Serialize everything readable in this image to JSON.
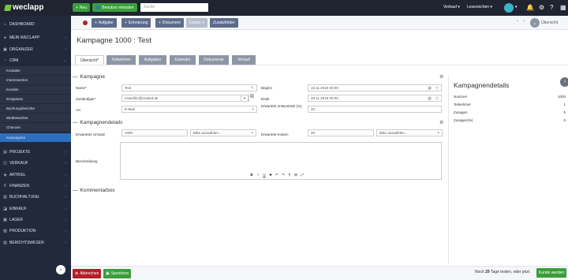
{
  "topbar": {
    "brand": "weclapp",
    "new_label": "Neu",
    "invite_label": "Benutzer einladen",
    "search_placeholder": "Suche",
    "sales_label": "Verkauf",
    "bookmarks_label": "Lesezeichen"
  },
  "sidebar": {
    "items": [
      {
        "label": "DASHBOARD",
        "icon": "dashboard-icon"
      },
      {
        "label": "MEIN WECLAPP",
        "icon": "user-icon"
      },
      {
        "label": "ORGANIZER",
        "icon": "calendar-icon"
      },
      {
        "label": "CRM",
        "icon": "crm-icon"
      }
    ],
    "crm_sub": [
      "Kontakte",
      "Interessenten",
      "Kunden",
      "Ereignisse",
      "Buchungsberichte",
      "Wettbewerber",
      "Chancen",
      "Kampagnen"
    ],
    "modules": [
      {
        "label": "PROJEKTE",
        "icon": "folder-icon"
      },
      {
        "label": "VERKAUF",
        "icon": "cart-icon"
      },
      {
        "label": "ARTIKEL",
        "icon": "tag-icon"
      },
      {
        "label": "FINANZEN",
        "icon": "money-icon"
      },
      {
        "label": "BUCHHALTUNG",
        "icon": "book-icon"
      },
      {
        "label": "EINKAUF",
        "icon": "basket-icon"
      },
      {
        "label": "LAGER",
        "icon": "warehouse-icon"
      },
      {
        "label": "PRODUKTION",
        "icon": "factory-icon"
      },
      {
        "label": "BERICHTSWESEN",
        "icon": "report-icon"
      }
    ]
  },
  "toolbar": {
    "task_label": "Aufgabe",
    "reminder_label": "Erinnerung",
    "document_label": "Dokument",
    "export_label": "Export",
    "extra_fields_label": "Zusatzfelder",
    "overview_label": "Übersicht"
  },
  "page": {
    "title": "Kampagne 1000 : Test"
  },
  "tabs": [
    "Übersicht*",
    "Teilnehmer",
    "Aufgaben",
    "Kalender",
    "Dokumente",
    "Verlauf"
  ],
  "kampagne": {
    "heading": "Kampagne",
    "name_label": "Name*",
    "name_value": "Test",
    "owner_label": "Zuständiger*",
    "owner_value": "mvachlin@trusted.de",
    "type_label": "Art",
    "type_value": "E-Mail",
    "start_label": "Beginn",
    "start_value": "15.11.2019 00:00",
    "end_label": "Ende",
    "end_value": "29.11.2019 00:00",
    "response_label": "Erwartete Antwortrate (%)",
    "response_value": "20"
  },
  "details": {
    "heading": "Kampagnendetails",
    "revenue_label": "Erwarteter Umsatz",
    "revenue_value": "1000",
    "select_placeholder": "Bitte auswählen...",
    "costs_label": "Erwartete Kosten",
    "costs_value": "20",
    "description_label": "Beschreibung"
  },
  "comments": {
    "heading": "Kommentarbox"
  },
  "right_panel": {
    "title": "Kampagnendetails",
    "rows": [
      {
        "label": "Nummer",
        "value": "1000"
      },
      {
        "label": "Teilnehmer",
        "value": "1"
      },
      {
        "label": "Zusagen",
        "value": "0"
      },
      {
        "label": "Zusagen(%)",
        "value": "0"
      }
    ]
  },
  "footer": {
    "cancel_label": "Abbrechen",
    "save_label": "Speichern",
    "trial_prefix": "Noch",
    "trial_days": "29",
    "trial_suffix": "Tage testen, oder jetzt",
    "buy_label": "Kunde werden"
  },
  "colors": {
    "sidebar_bg": "#22293a",
    "topbar_bg": "#1f2430",
    "accent_green": "#3a9e3a",
    "active_blue": "#2e6ebf",
    "toolbar_btn": "#5b6b8c",
    "cancel_red": "#b32025"
  }
}
